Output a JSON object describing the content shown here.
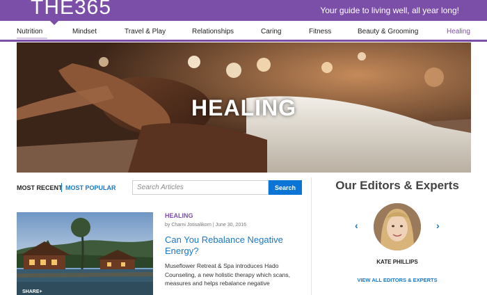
{
  "header": {
    "logo": "THE365",
    "tagline": "Your guide to living well, all year long!",
    "brand_color": "#7b4fa8"
  },
  "nav": {
    "items": [
      "Nutrition",
      "Mindset",
      "Travel & Play",
      "Relationships",
      "Caring",
      "Fitness",
      "Beauty & Grooming",
      "Healing"
    ],
    "active": "Healing"
  },
  "hero": {
    "title": "HEALING"
  },
  "listing": {
    "tab_recent": "MOST RECENT",
    "tab_popular": "MOST POPULAR",
    "search_placeholder": "Search Articles",
    "search_button": "Search"
  },
  "article": {
    "category": "HEALING",
    "byline": "by Charni Jotisalikorn | June 30, 2016",
    "headline": "Can You Rebalance Negative Energy?",
    "excerpt": "Museflower Retreat & Spa introduces Hado Counseling, a new holistic therapy which scans, measures and helps rebalance negative",
    "share_label": "SHARE+"
  },
  "editors": {
    "title": "Our Editors & Experts",
    "name": "KATE PHILLIPS",
    "view_all": "VIEW ALL EDITORS & EXPERTS",
    "prev_icon": "chevron-left-icon",
    "next_icon": "chevron-right-icon"
  },
  "colors": {
    "link_blue": "#1a78c8",
    "search_blue": "#0b74d4"
  }
}
